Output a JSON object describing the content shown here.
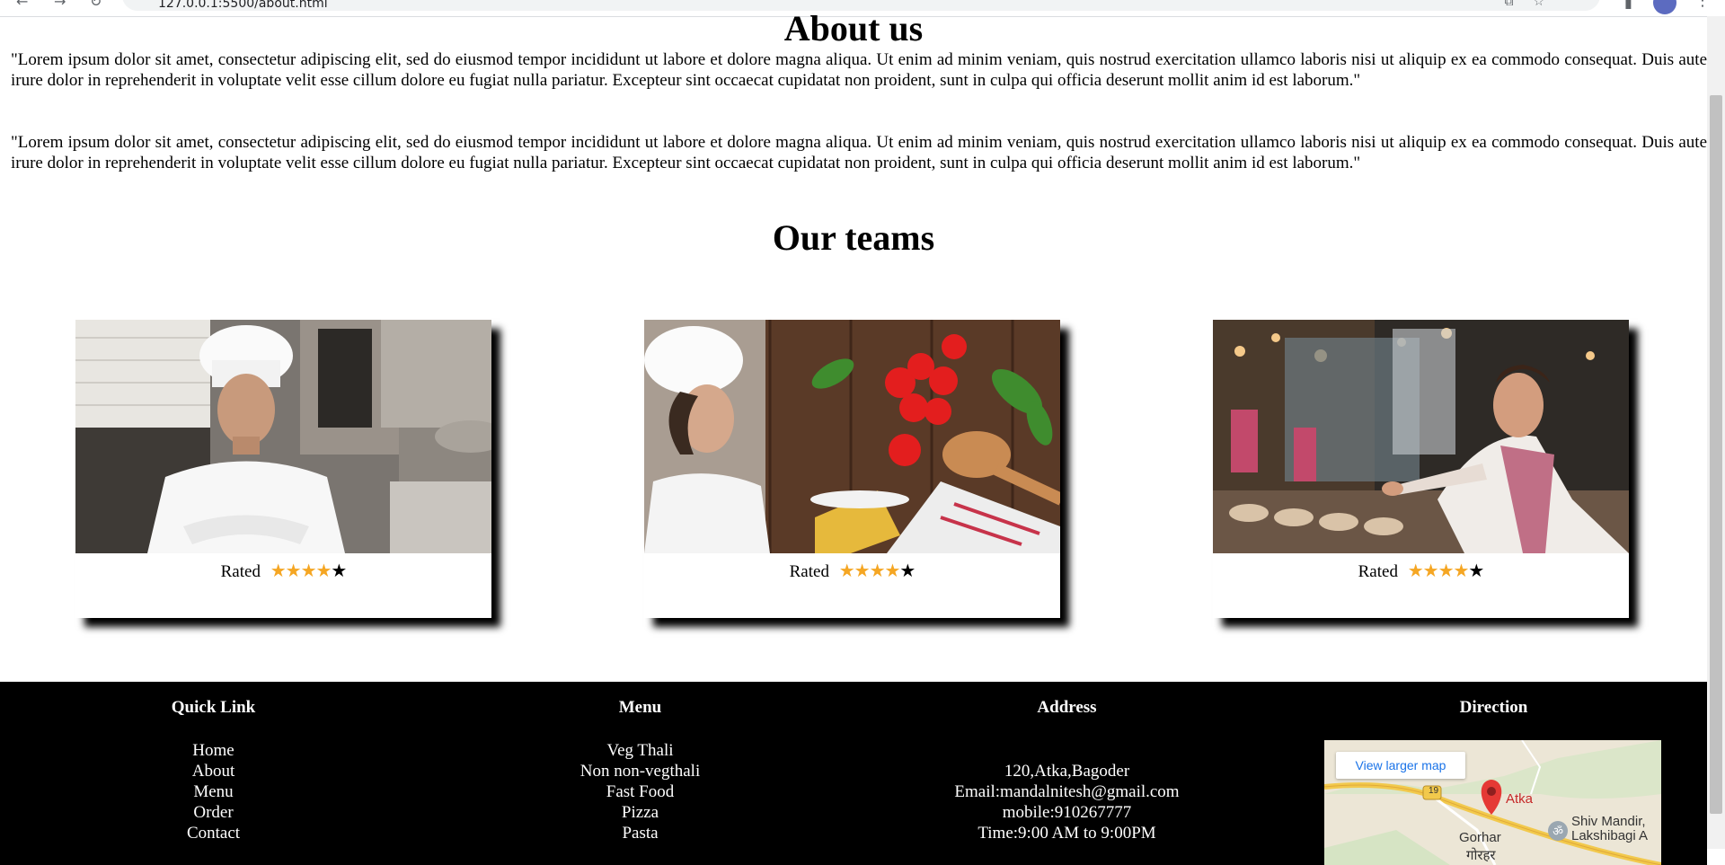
{
  "browser": {
    "url": "127.0.0.1:5500/about.html"
  },
  "about": {
    "title": "About us",
    "paragraphs": [
      "\"Lorem ipsum dolor sit amet, consectetur adipiscing elit, sed do eiusmod tempor incididunt ut labore et dolore magna aliqua. Ut enim ad minim veniam, quis nostrud exercitation ullamco laboris nisi ut aliquip ex ea commodo consequat. Duis aute irure dolor in reprehenderit in voluptate velit esse cillum dolore eu fugiat nulla pariatur. Excepteur sint occaecat cupidatat non proident, sunt in culpa qui officia deserunt mollit anim id est laborum.\"",
      "\"Lorem ipsum dolor sit amet, consectetur adipiscing elit, sed do eiusmod tempor incididunt ut labore et dolore magna aliqua. Ut enim ad minim veniam, quis nostrud exercitation ullamco laboris nisi ut aliquip ex ea commodo consequat. Duis aute irure dolor in reprehenderit in voluptate velit esse cillum dolore eu fugiat nulla pariatur. Excepteur sint occaecat cupidatat non proident, sunt in culpa qui officia deserunt mollit anim id est laborum.\""
    ]
  },
  "teams": {
    "title": "Our teams",
    "cards": [
      {
        "rating_label": "Rated",
        "stars": 4,
        "max_stars": 5,
        "stars_text": "★★★★",
        "empty_text": "★"
      },
      {
        "rating_label": "Rated",
        "stars": 4,
        "max_stars": 5,
        "stars_text": "★★★★",
        "empty_text": "★"
      },
      {
        "rating_label": "Rated",
        "stars": 4,
        "max_stars": 5,
        "stars_text": "★★★★",
        "empty_text": "★"
      }
    ]
  },
  "footer": {
    "quick_link": {
      "title": "Quick Link",
      "items": [
        "Home",
        "About",
        "Menu",
        "Order",
        "Contact"
      ]
    },
    "menu": {
      "title": "Menu",
      "items": [
        "Veg Thali",
        "Non non-vegthali",
        "Fast Food",
        "Pizza",
        "Pasta"
      ]
    },
    "address": {
      "title": "Address",
      "lines": [
        "120,Atka,Bagoder",
        "Email:mandalnitesh@gmail.com",
        "mobile:910267777",
        "Time:9:00 AM to 9:00PM"
      ]
    },
    "direction": {
      "title": "Direction",
      "map_button": "View larger map",
      "map_labels": {
        "place": "Atka",
        "road": "19",
        "poi": "Shiv Mandir, Lakshibagi A",
        "town": "Gorhar",
        "town_hi": "गोरहर"
      }
    }
  },
  "colors": {
    "star": "#f5a623",
    "footer_bg": "#000000",
    "map_link": "#1a73e8"
  }
}
